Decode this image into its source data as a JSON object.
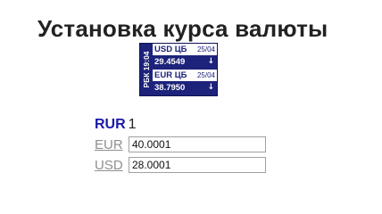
{
  "page": {
    "title": "Установка курса валюты"
  },
  "widget": {
    "source_label": "РБК 19:04",
    "rows": [
      {
        "currency": "USD ЦБ",
        "date": "25/04",
        "value": "29.4549",
        "trend": "↓",
        "trend_icon": "arrow-down-icon"
      },
      {
        "currency": "EUR ЦБ",
        "date": "25/04",
        "value": "38.7950",
        "trend": "↓",
        "trend_icon": "arrow-down-icon"
      }
    ],
    "colors": {
      "background": "#1d237a",
      "text": "#ffffff"
    }
  },
  "base": {
    "code": "RUR",
    "value": "1"
  },
  "currencies": [
    {
      "code": "EUR",
      "value": "40.0001"
    },
    {
      "code": "USD",
      "value": "28.0001"
    }
  ],
  "colors": {
    "title": "#222222",
    "base_code": "#1a1aa8",
    "link": "#8f8f8f"
  }
}
